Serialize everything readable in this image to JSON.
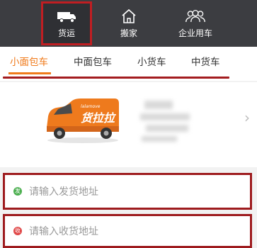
{
  "nav": {
    "items": [
      {
        "label": "货运",
        "icon": "van-icon"
      },
      {
        "label": "搬家",
        "icon": "house-icon"
      },
      {
        "label": "企业用车",
        "icon": "people-icon"
      }
    ]
  },
  "tabs": [
    "小面包车",
    "中面包车",
    "小货车",
    "中货车"
  ],
  "vehicle": {
    "brand_text": "货拉拉",
    "brand_text_small": "lalamove"
  },
  "addresses": {
    "from_placeholder": "请输入发货地址",
    "to_placeholder": "请输入收货地址",
    "from_badge": "发",
    "to_badge": "收"
  },
  "colors": {
    "accent": "#f07a1a",
    "nav_bg": "#3c3d41",
    "highlight": "#c01e22"
  }
}
